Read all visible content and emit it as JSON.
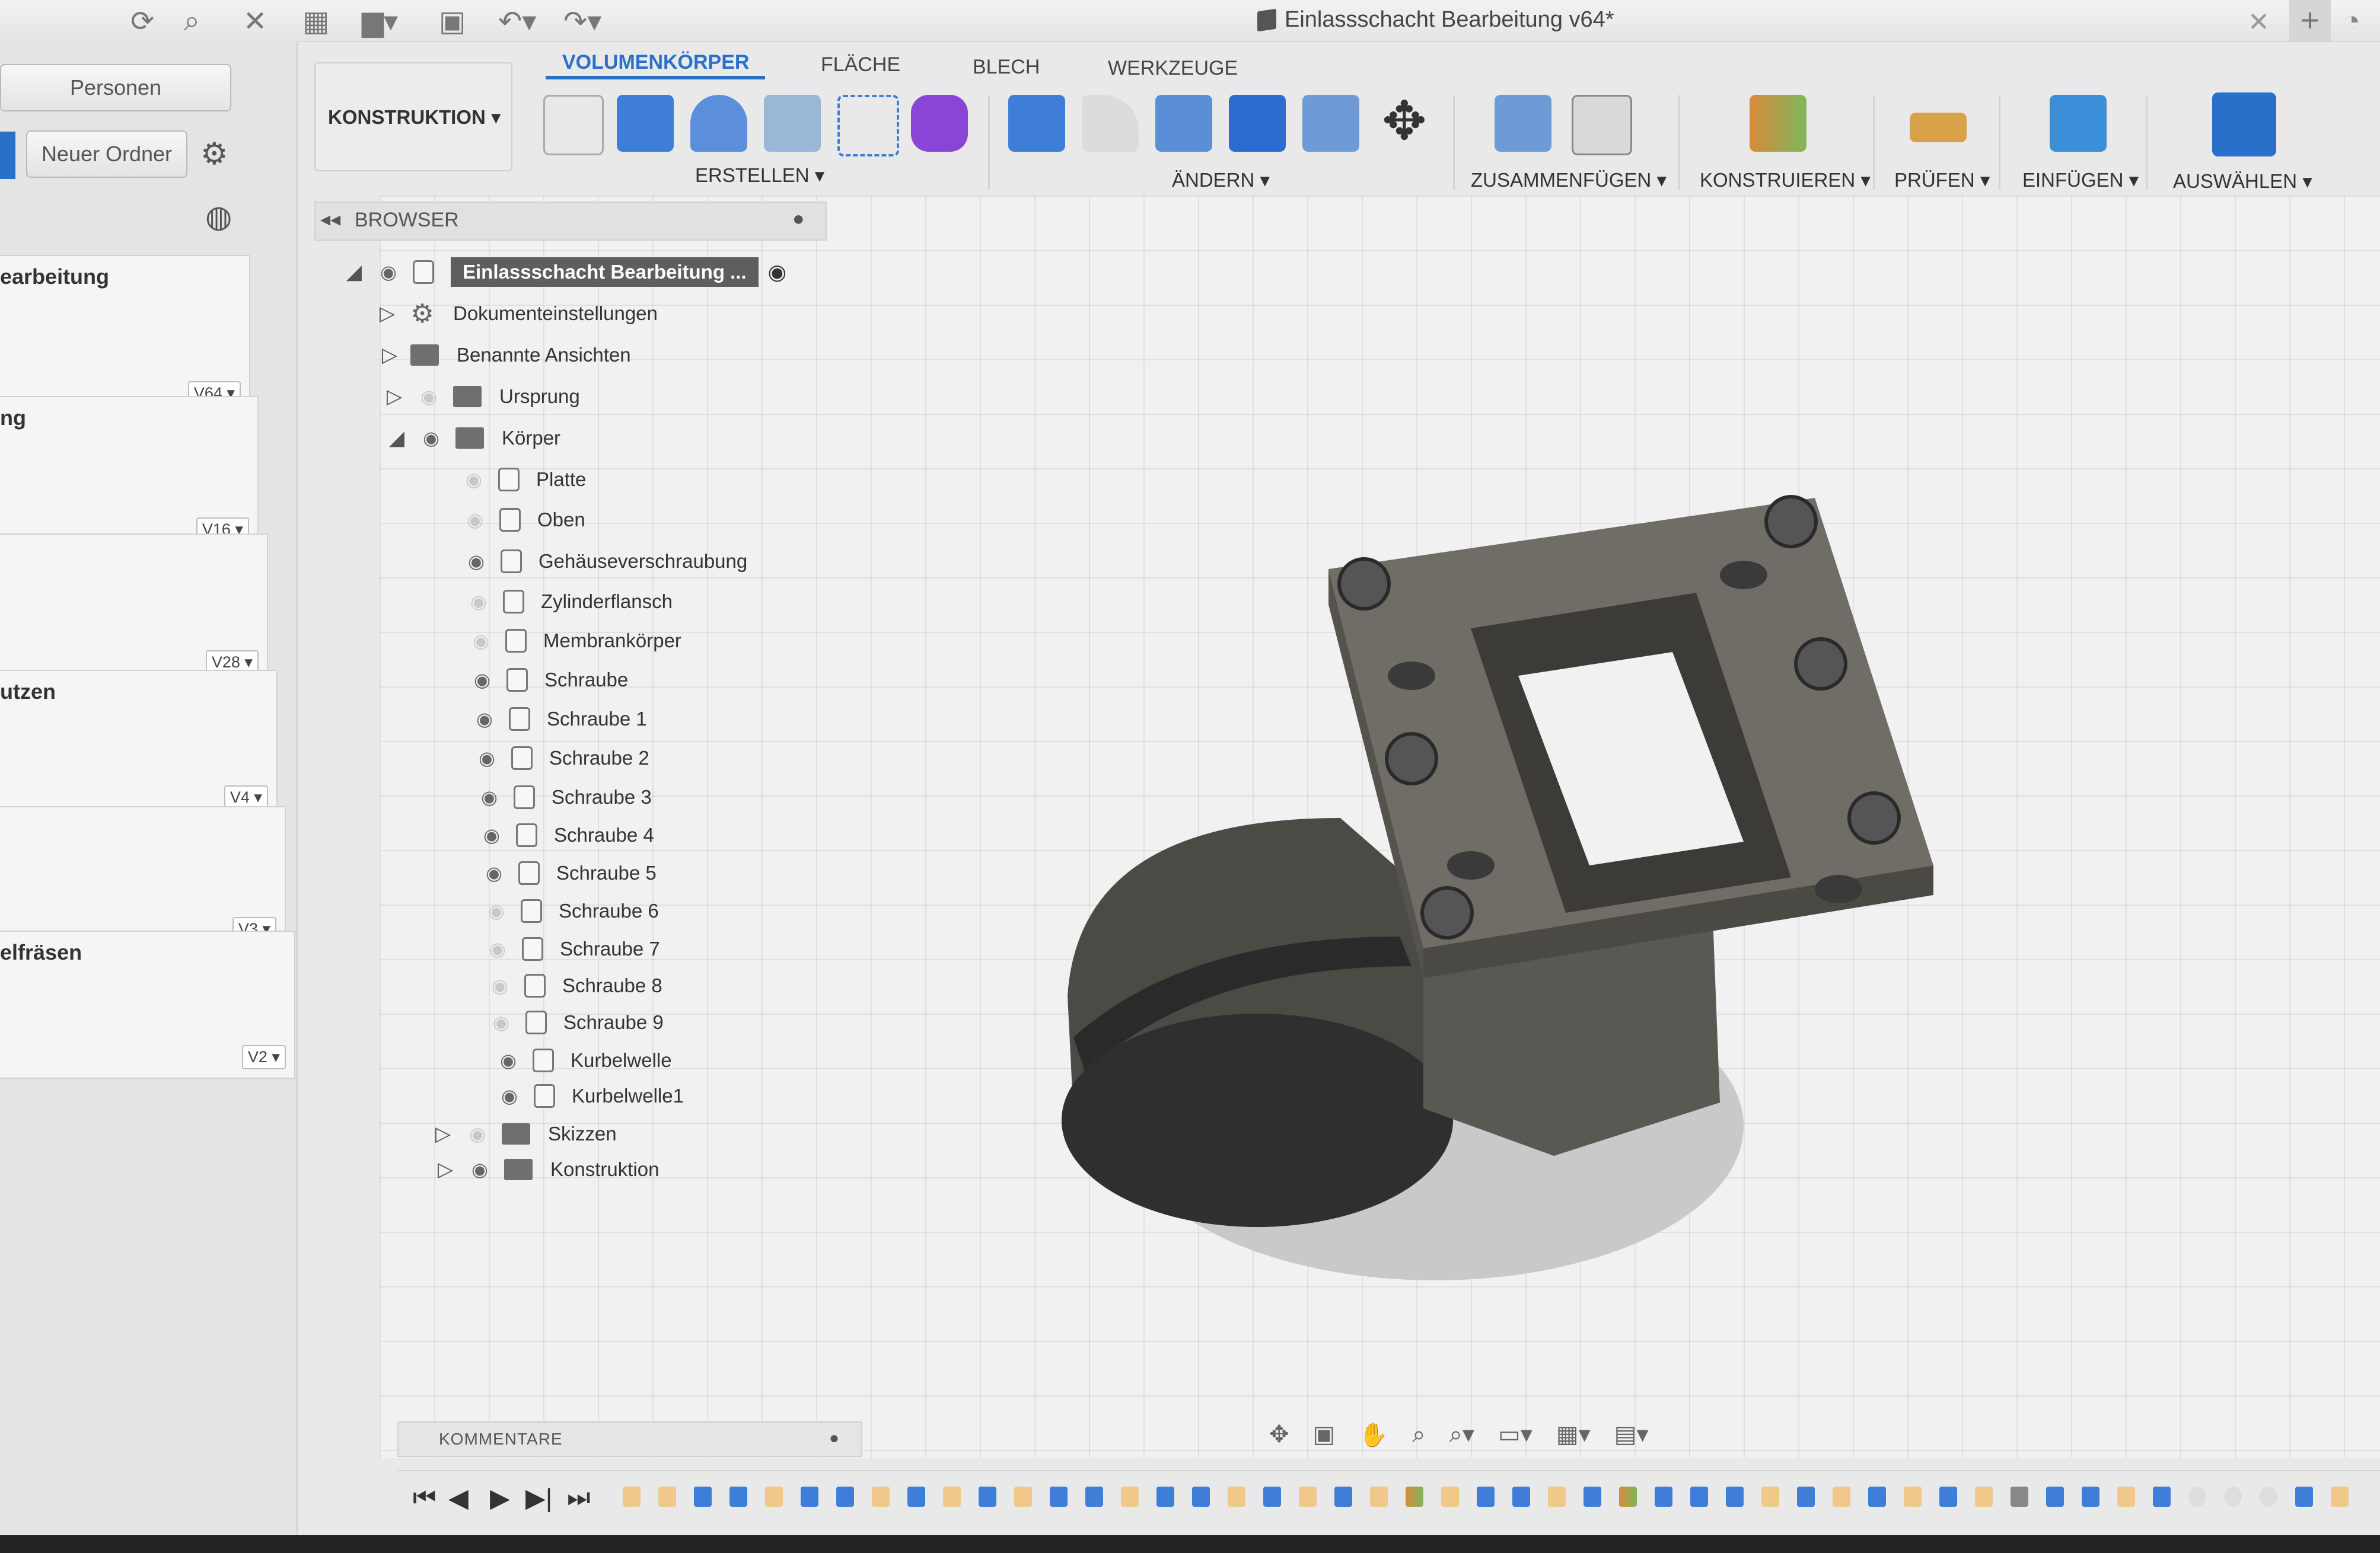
{
  "window": {
    "title": "Einlassschacht Bearbeitung v64*"
  },
  "left_panel": {
    "persons_button": "Personen",
    "new_folder_button": "Neuer Ordner",
    "cards": [
      {
        "title": "earbeitung",
        "version": "V64 ▾"
      },
      {
        "title": "ng",
        "version": "V16 ▾"
      },
      {
        "title": "",
        "version": "V28 ▾"
      },
      {
        "title": "utzen",
        "version": "V4 ▾"
      },
      {
        "title": "",
        "version": "V3 ▾"
      },
      {
        "title": "elfräsen",
        "version": "V2 ▾"
      }
    ]
  },
  "toolbar": {
    "workspace": "KONSTRUKTION ▾",
    "tabs": [
      "VOLUMENKÖRPER",
      "FLÄCHE",
      "BLECH",
      "WERKZEUGE"
    ],
    "groups": {
      "create": "ERSTELLEN ▾",
      "modify": "ÄNDERN ▾",
      "assemble": "ZUSAMMENFÜGEN ▾",
      "construct": "KONSTRUIEREN ▾",
      "inspect": "PRÜFEN ▾",
      "insert": "EINFÜGEN ▾",
      "select": "AUSWÄHLEN ▾"
    }
  },
  "browser": {
    "title": "BROWSER",
    "root": "Einlassschacht Bearbeitung ...",
    "items": [
      "Dokumenteinstellungen",
      "Benannte Ansichten",
      "Ursprung",
      "Körper",
      "Platte",
      "Oben",
      "Gehäuseverschraubung",
      "Zylinderflansch",
      "Membrankörper",
      "Schraube",
      "Schraube 1",
      "Schraube 2",
      "Schraube 3",
      "Schraube 4",
      "Schraube 5",
      "Schraube 6",
      "Schraube 7",
      "Schraube 8",
      "Schraube 9",
      "Kurbelwelle",
      "Kurbelwelle1",
      "Skizzen",
      "Konstruktion"
    ]
  },
  "comments": {
    "label": "KOMMENTARE"
  },
  "icons": [
    "refresh-icon",
    "search-icon",
    "close-icon",
    "grid-icon",
    "file-icon",
    "save-icon",
    "undo-icon",
    "redo-icon",
    "gear-icon",
    "globe-icon",
    "eye-icon",
    "folder-icon",
    "body-icon",
    "play-icon"
  ]
}
